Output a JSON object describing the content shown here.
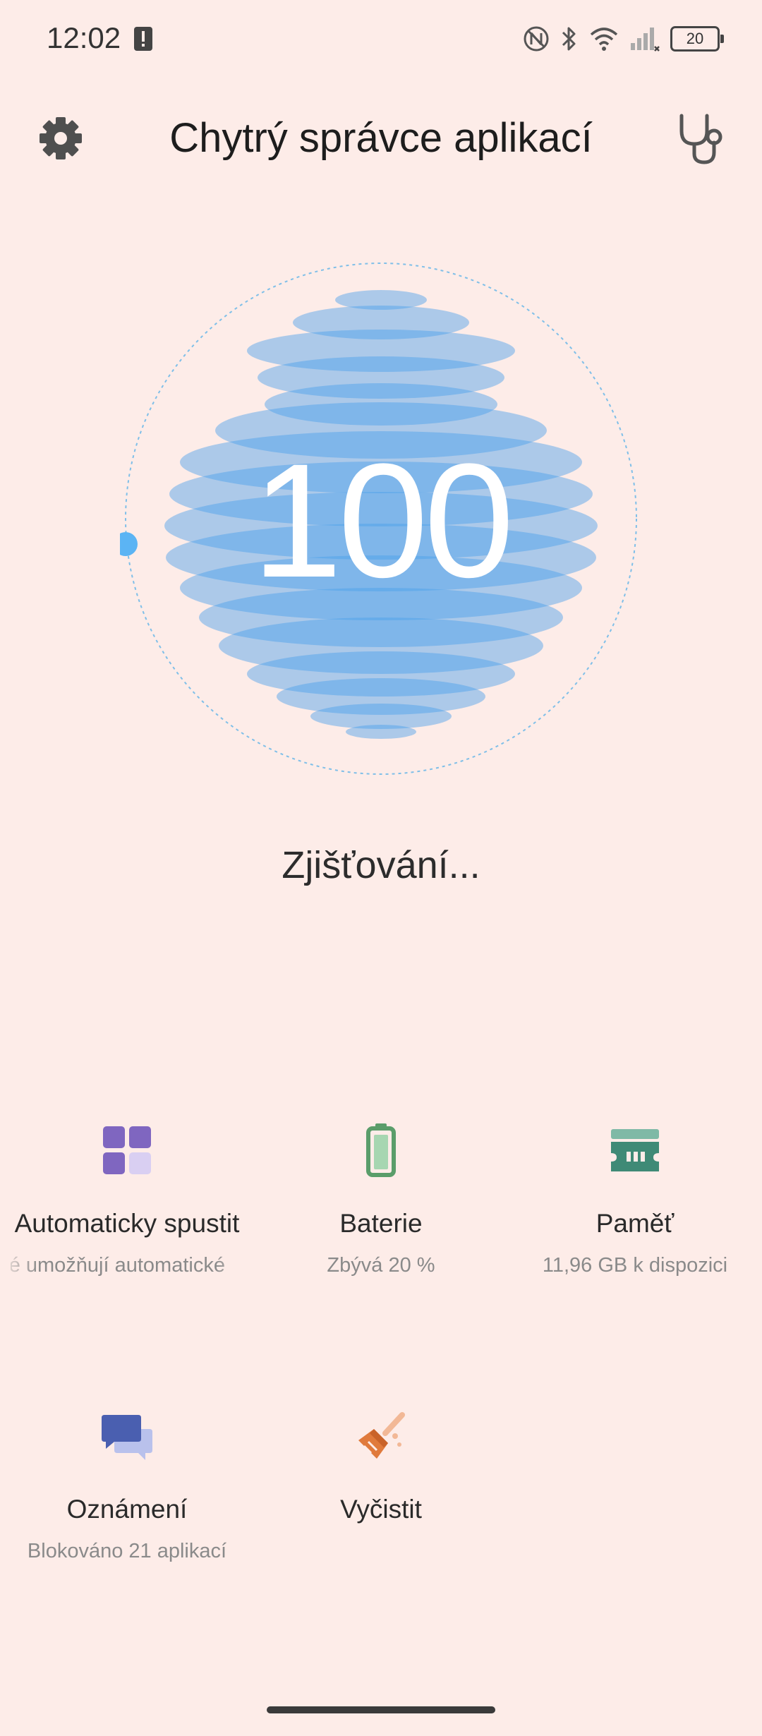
{
  "status_bar": {
    "time": "12:02",
    "battery_level": "20",
    "icons": [
      "alert-icon",
      "nfc-off-icon",
      "bluetooth-icon",
      "wifi-icon",
      "signal-icon",
      "battery-icon"
    ]
  },
  "header": {
    "title": "Chytrý správce aplikací",
    "settings_icon": "gear-icon",
    "diagnostics_icon": "stethoscope-icon"
  },
  "scan": {
    "score": "100",
    "status": "Zjišťování..."
  },
  "tiles": [
    {
      "label": "Automaticky spustit",
      "sub": "ré umožňují automatické",
      "icon": "apps-grid-icon",
      "color": "#7f66c0"
    },
    {
      "label": "Baterie",
      "sub": "Zbývá 20 %",
      "icon": "battery-icon",
      "color": "#5a9d6a"
    },
    {
      "label": "Paměť",
      "sub": "11,96 GB k dispozici",
      "icon": "memory-icon",
      "color": "#3f8a76"
    },
    {
      "label": "Oznámení",
      "sub": "Blokováno 21 aplikací",
      "icon": "chat-bubbles-icon",
      "color": "#4a5fb0"
    },
    {
      "label": "Vyčistit",
      "sub": "",
      "icon": "broom-icon",
      "color": "#e07a3c"
    }
  ],
  "colors": {
    "background": "#fdece8",
    "globe": "#4da2ea",
    "accent": "#5bb4f4"
  }
}
